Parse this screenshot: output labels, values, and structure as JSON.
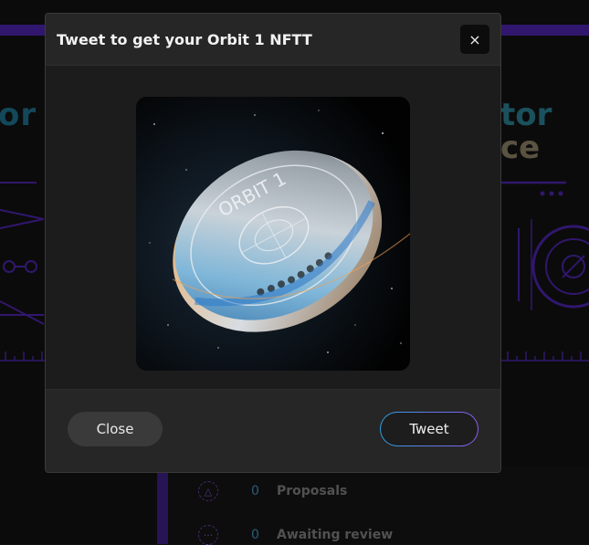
{
  "background": {
    "left_title": "or",
    "right_title_line1": "tor",
    "right_title_line2": "ce",
    "stats": [
      {
        "icon": "triangle-icon",
        "count": "0",
        "label": "Proposals"
      },
      {
        "icon": "dots-icon",
        "count": "0",
        "label": "Awaiting review"
      }
    ]
  },
  "modal": {
    "title": "Tweet to get your Orbit 1 NFTT",
    "close_icon": "×",
    "image_alt": "Orbit 1 coin NFT",
    "coin_text": "ORBIT 1",
    "close_label": "Close",
    "tweet_label": "Tweet"
  },
  "colors": {
    "accent_purple": "#4b24a8",
    "tweet_gradient_start": "#2e9fe0",
    "tweet_gradient_end": "#8d5bf0"
  }
}
